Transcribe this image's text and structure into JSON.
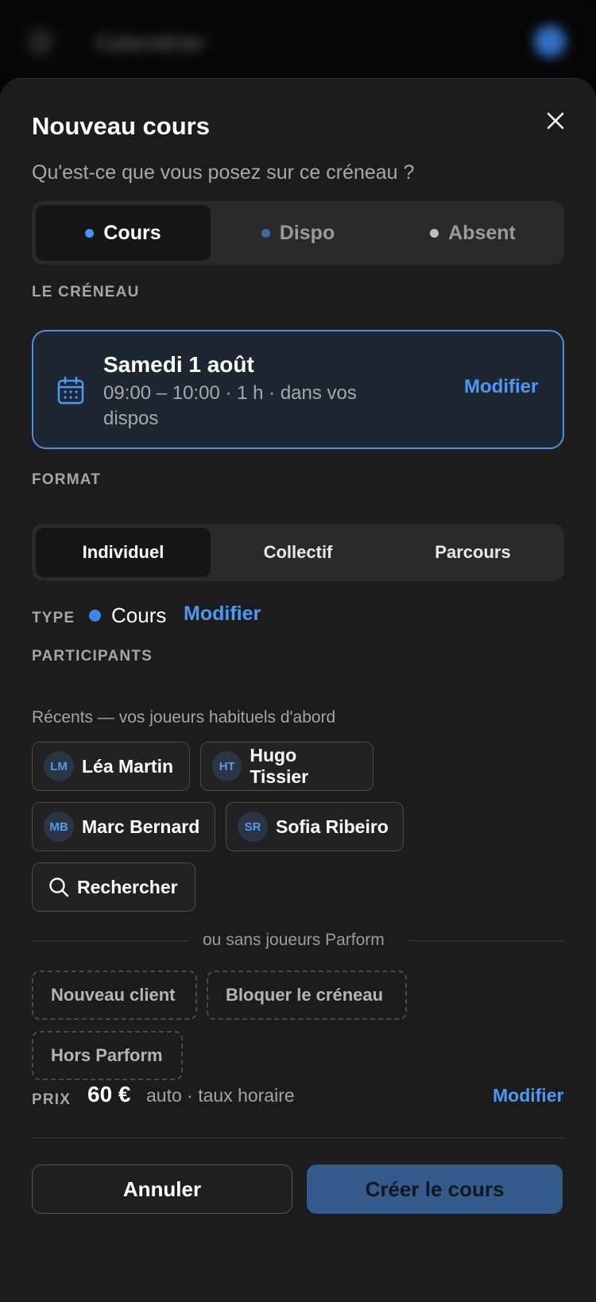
{
  "header": {
    "title": "Calendrier"
  },
  "sheet": {
    "title": "Nouveau cours",
    "subtitle": "Qu'est-ce que vous posez sur ce créneau ?"
  },
  "kind_tabs": [
    {
      "label": "Cours",
      "dot_color": "#4a90f5",
      "active": true
    },
    {
      "label": "Dispo",
      "dot_color": "#3c6aa8",
      "active": false
    },
    {
      "label": "Absent",
      "dot_color": "#bdbdbd",
      "active": false
    }
  ],
  "slot": {
    "section_label": "LE CRÉNEAU",
    "day": "Samedi 1 août",
    "time": "09:00 – 10:00 · 1 h · dans vos dispos",
    "modify_label": "Modifier"
  },
  "format": {
    "section_label": "FORMAT",
    "options": [
      "Individuel",
      "Collectif",
      "Parcours"
    ],
    "selected_index": 0
  },
  "type": {
    "label": "TYPE",
    "value": "Cours",
    "modify_label": "Modifier"
  },
  "participants": {
    "section_label": "PARTICIPANTS",
    "hint": "Récents — vos joueurs habituels d'abord",
    "recent": [
      {
        "initials": "LM",
        "name": "Léa Martin"
      },
      {
        "initials": "HT",
        "name": "Hugo Tissier"
      },
      {
        "initials": "MB",
        "name": "Marc Bernard"
      },
      {
        "initials": "SR",
        "name": "Sofia Ribeiro"
      }
    ],
    "search_label": "Rechercher",
    "divider_text": "ou sans joueurs Parform",
    "alternatives": [
      "Nouveau client",
      "Bloquer le créneau",
      "Hors Parform"
    ]
  },
  "price": {
    "label": "PRIX",
    "value": "60 €",
    "note": "auto · taux horaire",
    "modify_label": "Modifier"
  },
  "actions": {
    "cancel_label": "Annuler",
    "create_label": "Créer le cours"
  },
  "colors": {
    "accent": "#4a9af5",
    "primary_button": "#345a8c",
    "slot_border": "#4a90e2"
  }
}
